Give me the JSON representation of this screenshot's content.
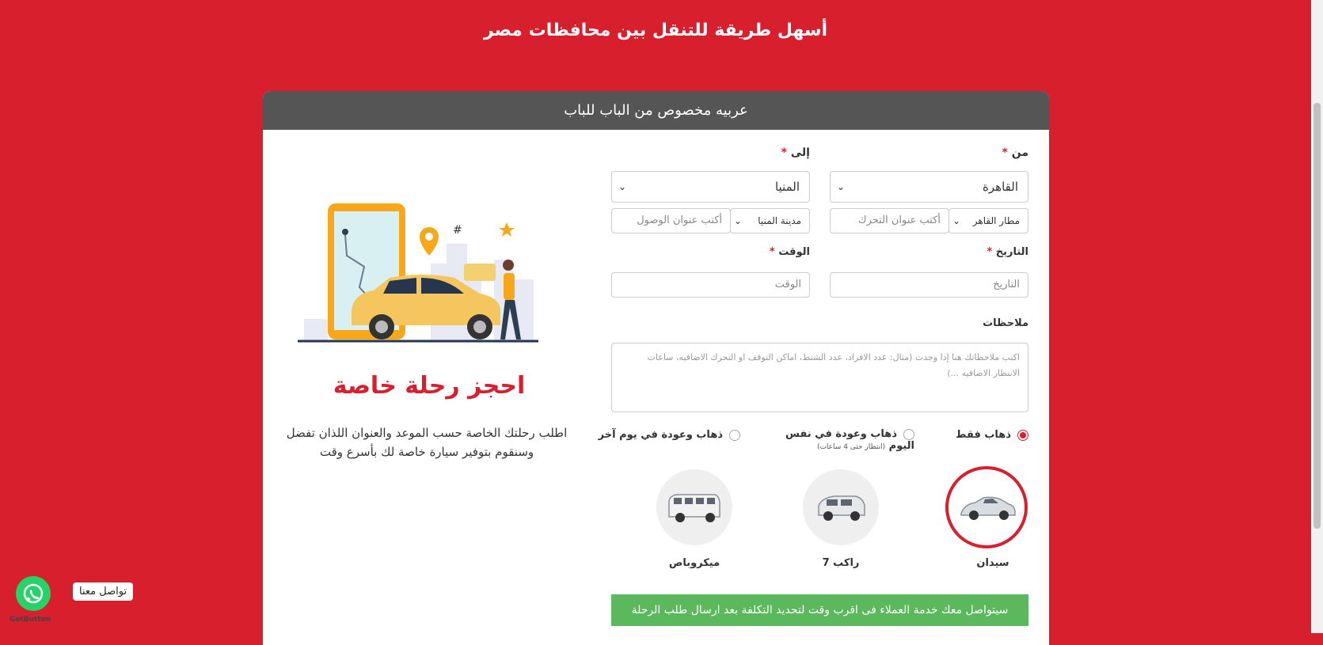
{
  "hero": {
    "title": "أسهل طريقة للتنقل بين محافظات مصر"
  },
  "card": {
    "header": "عربيه مخصوص من الباب للباب"
  },
  "form": {
    "from_label": "من",
    "to_label": "إلى",
    "from_value": "القاهرة",
    "to_value": "المنيا",
    "from_sub_select": "مطار القاهر",
    "from_address_placeholder": "أكتب عنوان التحرك",
    "to_sub_select": "مدينة المنيا",
    "to_address_placeholder": "أكتب عنوان الوصول",
    "date_label": "التاريخ",
    "time_label": "الوقت",
    "date_placeholder": "التاريخ",
    "time_placeholder": "الوقت",
    "notes_label": "ملاحظات",
    "notes_placeholder": "اكتب ملاحظاتك هنا إذا وجدت (مثال: عدد الافراد، عدد الشنط، اماكن التوقف او التحرك الاضافيه، ساعات الانتظار الاضافيه ...)",
    "required_mark": "*"
  },
  "trip_types": [
    {
      "label": "ذهاب فقط",
      "note": "",
      "selected": true
    },
    {
      "label": "ذهاب وعودة في نفس اليوم",
      "note": "(انتظار حتى 4 ساعات)",
      "selected": false
    },
    {
      "label": "ذهاب وعودة في يوم آخر",
      "note": "",
      "selected": false
    }
  ],
  "vehicles": [
    {
      "label": "سيدان",
      "selected": true
    },
    {
      "label": "7 راكب",
      "selected": false
    },
    {
      "label": "ميكروباص",
      "selected": false
    }
  ],
  "notice": "سيتواصل معك خدمة العملاء فى اقرب وقت لتحديد التكلفة بعد ارسال طلب الرحلة",
  "promo": {
    "title": "احجز رحلة خاصة",
    "text": "اطلب رحلتك الخاصة حسب الموعد والعنوان اللذان تفضل وسنقوم بتوفير سيارة خاصة لك بأسرع وقت"
  },
  "whatsapp": {
    "tooltip": "تواصل معنا",
    "brand": "GetButton"
  },
  "colors": {
    "brand_red": "#d71f2d",
    "header_gray": "#555555",
    "notice_green": "#5cb85c",
    "car_yellow": "#f6c25b"
  }
}
